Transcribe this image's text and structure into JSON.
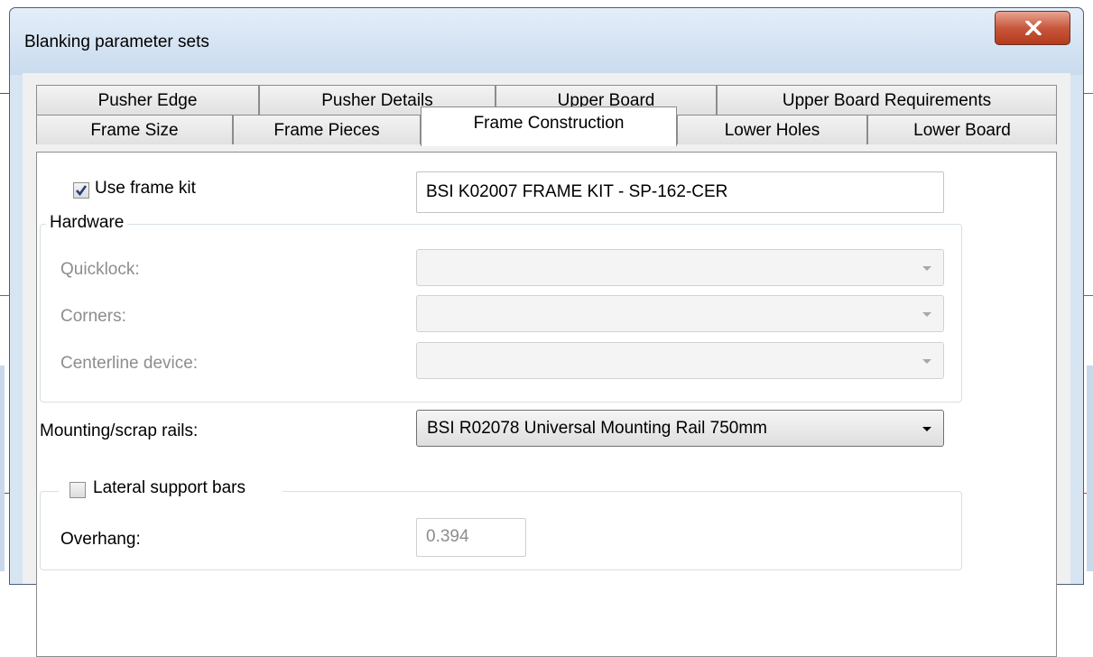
{
  "window": {
    "title": "Blanking parameter sets",
    "close_glyph": "X"
  },
  "tabs": {
    "row1": [
      "Pusher Edge",
      "Pusher Details",
      "Upper Board",
      "Upper Board Requirements"
    ],
    "row2": [
      "Frame Size",
      "Frame Pieces",
      "Frame Construction",
      "Lower Holes",
      "Lower Board"
    ],
    "selected": "Frame Construction"
  },
  "frame_kit": {
    "label": "Use frame kit",
    "checked": true,
    "value": "BSI K02007 FRAME KIT - SP-162-CER"
  },
  "hardware": {
    "title": "Hardware",
    "quicklock_label": "Quicklock:",
    "corners_label": "Corners:",
    "centerline_label": "Centerline device:"
  },
  "mounting": {
    "label": "Mounting/scrap rails:",
    "value": "BSI R02078 Universal Mounting Rail 750mm"
  },
  "lateral": {
    "label": "Lateral support bars",
    "checked": false,
    "overhang_label": "Overhang:",
    "overhang_value": "0.394"
  },
  "colors": {
    "title_bar": "#c9dbee",
    "close_button": "#c8583d",
    "panel": "#ffffff"
  }
}
